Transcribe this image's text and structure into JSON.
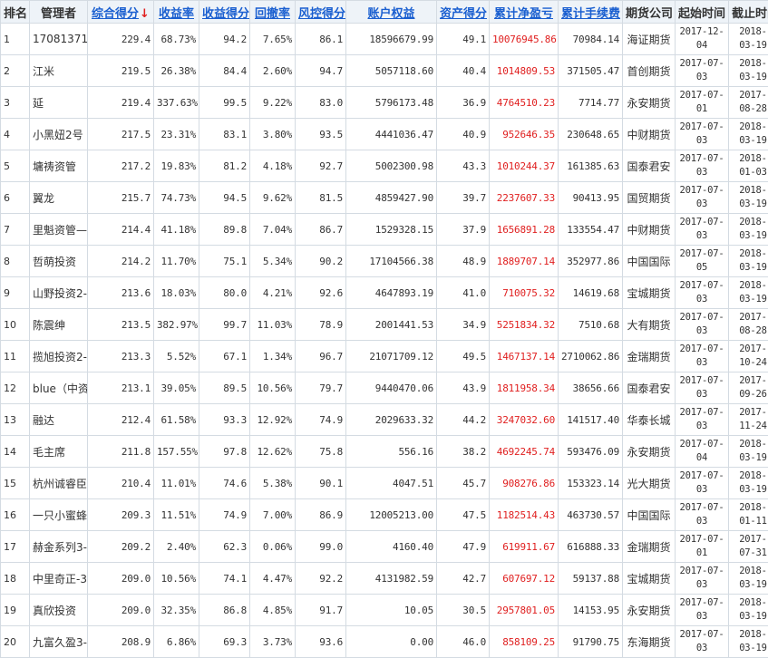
{
  "table": {
    "headers": {
      "rank": "排名",
      "manager": "管理者",
      "composite_score": "综合得分",
      "sort_arrow": "↓",
      "return_rate": "收益率",
      "return_score": "收益得分",
      "drawdown": "回撤率",
      "risk_score": "风控得分",
      "equity": "账户权益",
      "asset_score": "资产得分",
      "net_profit": "累计净盈亏",
      "fees": "累计手续费",
      "broker": "期货公司",
      "start_date": "起始时间",
      "end_date": "截止时间"
    },
    "rows": [
      {
        "rank": "1",
        "manager": "170813717:",
        "score": "229.4",
        "ret": "68.73%",
        "rs": "94.2",
        "dd": "7.65%",
        "risk": "86.1",
        "equity": "18596679.99",
        "asset": "49.1",
        "profit": "10076945.86",
        "fee": "70984.14",
        "broker": "海证期货",
        "start": "2017-12-04",
        "end": "2018-03-19"
      },
      {
        "rank": "2",
        "manager": "江米",
        "score": "219.5",
        "ret": "26.38%",
        "rs": "84.4",
        "dd": "2.60%",
        "risk": "94.7",
        "equity": "5057118.60",
        "asset": "40.4",
        "profit": "1014809.53",
        "fee": "371505.47",
        "broker": "首创期货",
        "start": "2017-07-03",
        "end": "2018-03-19"
      },
      {
        "rank": "3",
        "manager": "延",
        "score": "219.4",
        "ret": "337.63%",
        "rs": "99.5",
        "dd": "9.22%",
        "risk": "83.0",
        "equity": "5796173.48",
        "asset": "36.9",
        "profit": "4764510.23",
        "fee": "7714.77",
        "broker": "永安期货",
        "start": "2017-07-01",
        "end": "2017-08-28"
      },
      {
        "rank": "4",
        "manager": "小黑妞2号",
        "score": "217.5",
        "ret": "23.31%",
        "rs": "83.1",
        "dd": "3.80%",
        "risk": "93.5",
        "equity": "4441036.47",
        "asset": "40.9",
        "profit": "952646.35",
        "fee": "230648.65",
        "broker": "中财期货",
        "start": "2017-07-03",
        "end": "2018-03-19"
      },
      {
        "rank": "5",
        "manager": "墉祷资管",
        "score": "217.2",
        "ret": "19.83%",
        "rs": "81.2",
        "dd": "4.18%",
        "risk": "92.7",
        "equity": "5002300.98",
        "asset": "43.3",
        "profit": "1010244.37",
        "fee": "161385.63",
        "broker": "国泰君安",
        "start": "2017-07-03",
        "end": "2018-01-03"
      },
      {
        "rank": "6",
        "manager": "翼龙",
        "score": "215.7",
        "ret": "74.73%",
        "rs": "94.5",
        "dd": "9.62%",
        "risk": "81.5",
        "equity": "4859427.90",
        "asset": "39.7",
        "profit": "2237607.33",
        "fee": "90413.95",
        "broker": "国贸期货",
        "start": "2017-07-03",
        "end": "2018-03-19"
      },
      {
        "rank": "7",
        "manager": "里魁资管—",
        "score": "214.4",
        "ret": "41.18%",
        "rs": "89.8",
        "dd": "7.04%",
        "risk": "86.7",
        "equity": "1529328.15",
        "asset": "37.9",
        "profit": "1656891.28",
        "fee": "133554.47",
        "broker": "中财期货",
        "start": "2017-07-03",
        "end": "2018-03-19"
      },
      {
        "rank": "8",
        "manager": "哲萌投资",
        "score": "214.2",
        "ret": "11.70%",
        "rs": "75.1",
        "dd": "5.34%",
        "risk": "90.2",
        "equity": "17104566.38",
        "asset": "48.9",
        "profit": "1889707.14",
        "fee": "352977.86",
        "broker": "中国国际",
        "start": "2017-07-05",
        "end": "2018-03-19"
      },
      {
        "rank": "9",
        "manager": "山野投资2-",
        "score": "213.6",
        "ret": "18.03%",
        "rs": "80.0",
        "dd": "4.21%",
        "risk": "92.6",
        "equity": "4647893.19",
        "asset": "41.0",
        "profit": "710075.32",
        "fee": "14619.68",
        "broker": "宝城期货",
        "start": "2017-07-03",
        "end": "2018-03-19"
      },
      {
        "rank": "10",
        "manager": "陈震绅",
        "score": "213.5",
        "ret": "382.97%",
        "rs": "99.7",
        "dd": "11.03%",
        "risk": "78.9",
        "equity": "2001441.53",
        "asset": "34.9",
        "profit": "5251834.32",
        "fee": "7510.68",
        "broker": "大有期货",
        "start": "2017-07-03",
        "end": "2017-08-28"
      },
      {
        "rank": "11",
        "manager": "揽旭投资2-",
        "score": "213.3",
        "ret": "5.52%",
        "rs": "67.1",
        "dd": "1.34%",
        "risk": "96.7",
        "equity": "21071709.12",
        "asset": "49.5",
        "profit": "1467137.14",
        "fee": "2710062.86",
        "broker": "金瑞期货",
        "start": "2017-07-03",
        "end": "2017-10-24"
      },
      {
        "rank": "12",
        "manager": "blue（中资",
        "score": "213.1",
        "ret": "39.05%",
        "rs": "89.5",
        "dd": "10.56%",
        "risk": "79.7",
        "equity": "9440470.06",
        "asset": "43.9",
        "profit": "1811958.34",
        "fee": "38656.66",
        "broker": "国泰君安",
        "start": "2017-07-03",
        "end": "2017-09-26"
      },
      {
        "rank": "13",
        "manager": "融达",
        "score": "212.4",
        "ret": "61.58%",
        "rs": "93.3",
        "dd": "12.92%",
        "risk": "74.9",
        "equity": "2029633.32",
        "asset": "44.2",
        "profit": "3247032.60",
        "fee": "141517.40",
        "broker": "华泰长城",
        "start": "2017-07-03",
        "end": "2017-11-24"
      },
      {
        "rank": "14",
        "manager": "毛主席",
        "score": "211.8",
        "ret": "157.55%",
        "rs": "97.8",
        "dd": "12.62%",
        "risk": "75.8",
        "equity": "556.16",
        "asset": "38.2",
        "profit": "4692245.74",
        "fee": "593476.09",
        "broker": "永安期货",
        "start": "2017-07-04",
        "end": "2018-03-19"
      },
      {
        "rank": "15",
        "manager": "杭州诚睿臣",
        "score": "210.4",
        "ret": "11.01%",
        "rs": "74.6",
        "dd": "5.38%",
        "risk": "90.1",
        "equity": "4047.51",
        "asset": "45.7",
        "profit": "908276.86",
        "fee": "153323.14",
        "broker": "光大期货",
        "start": "2017-07-03",
        "end": "2018-03-19"
      },
      {
        "rank": "16",
        "manager": "一只小蜜蜂",
        "score": "209.3",
        "ret": "11.51%",
        "rs": "74.9",
        "dd": "7.00%",
        "risk": "86.9",
        "equity": "12005213.00",
        "asset": "47.5",
        "profit": "1182514.43",
        "fee": "463730.57",
        "broker": "中国国际",
        "start": "2017-07-03",
        "end": "2018-01-11"
      },
      {
        "rank": "17",
        "manager": "赫金系列3-",
        "score": "209.2",
        "ret": "2.40%",
        "rs": "62.3",
        "dd": "0.06%",
        "risk": "99.0",
        "equity": "4160.40",
        "asset": "47.9",
        "profit": "619911.67",
        "fee": "616888.33",
        "broker": "金瑞期货",
        "start": "2017-07-01",
        "end": "2017-07-31"
      },
      {
        "rank": "18",
        "manager": "中里奇正-3",
        "score": "209.0",
        "ret": "10.56%",
        "rs": "74.1",
        "dd": "4.47%",
        "risk": "92.2",
        "equity": "4131982.59",
        "asset": "42.7",
        "profit": "607697.12",
        "fee": "59137.88",
        "broker": "宝城期货",
        "start": "2017-07-03",
        "end": "2018-03-19"
      },
      {
        "rank": "19",
        "manager": "真欣投资",
        "score": "209.0",
        "ret": "32.35%",
        "rs": "86.8",
        "dd": "4.85%",
        "risk": "91.7",
        "equity": "10.05",
        "asset": "30.5",
        "profit": "2957801.05",
        "fee": "14153.95",
        "broker": "永安期货",
        "start": "2017-07-03",
        "end": "2018-03-19"
      },
      {
        "rank": "20",
        "manager": "九富久盈3-",
        "score": "208.9",
        "ret": "6.86%",
        "rs": "69.3",
        "dd": "3.73%",
        "risk": "93.6",
        "equity": "0.00",
        "asset": "46.0",
        "profit": "858109.25",
        "fee": "91790.75",
        "broker": "东海期货",
        "start": "2017-07-03",
        "end": "2018-03-19"
      }
    ]
  },
  "colors": {
    "header_bg": "#eef3f8",
    "header_link": "#1a5fd0",
    "profit_red": "#e02020",
    "border": "#d4dbe2"
  }
}
